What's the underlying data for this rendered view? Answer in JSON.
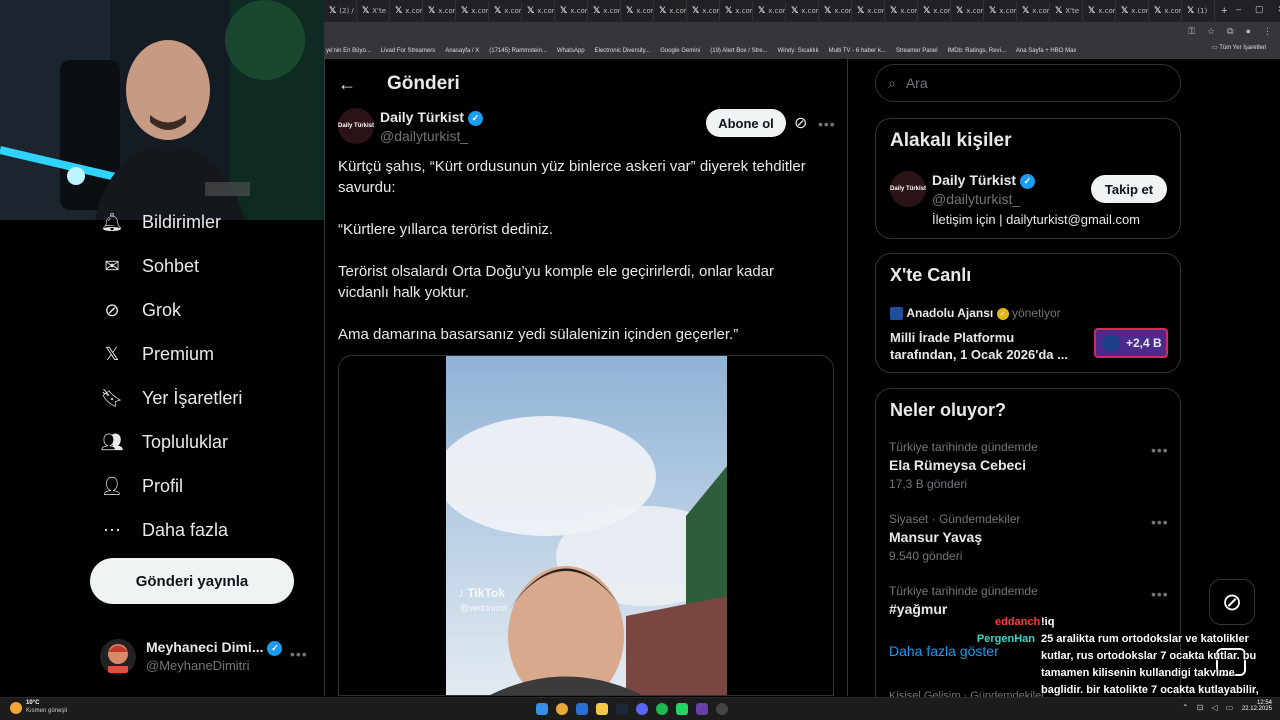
{
  "browser": {
    "tabs": [
      "(2) / X",
      "X'te",
      "x.com",
      "x.com",
      "x.com",
      "x.com",
      "x.com",
      "x.com",
      "x.com",
      "x.com",
      "x.com",
      "x.com",
      "x.com",
      "x.com",
      "x.com",
      "x.com",
      "x.com",
      "x.com",
      "x.com",
      "x.com",
      "x.com",
      "x.com",
      "X'te",
      "x.com",
      "x.com",
      "x.com",
      "(1)"
    ],
    "bookmarks": [
      "ye'nin En Büyo...",
      "Livad For Streamers",
      "Anasayfa / X",
      "(17145) Rammstein...",
      "WhatsApp",
      "Electronic Diversity...",
      "Google Gemini",
      "(19) Alert Box / Stre...",
      "Windy: Sıcaklık",
      "Multi TV - 6 haber k...",
      "Streamer Panel",
      "IMDb: Ratings, Revi...",
      "Ana Sayfa + HBO Max"
    ],
    "all_bookmarks": "Tüm Yer İşaretleri"
  },
  "nav": {
    "items": [
      {
        "label": "Bildirimler",
        "icon": "bell-icon"
      },
      {
        "label": "Sohbet",
        "icon": "mail-icon"
      },
      {
        "label": "Grok",
        "icon": "grok-icon"
      },
      {
        "label": "Premium",
        "icon": "x-logo-icon"
      },
      {
        "label": "Yer İşaretleri",
        "icon": "bookmark-icon"
      },
      {
        "label": "Topluluklar",
        "icon": "communities-icon"
      },
      {
        "label": "Profil",
        "icon": "person-icon"
      },
      {
        "label": "Daha fazla",
        "icon": "more-circle-icon"
      }
    ],
    "post_button": "Gönderi yayınla",
    "account": {
      "name": "Meyhaneci Dimi...",
      "handle": "@MeyhaneDimitri"
    }
  },
  "post": {
    "header_title": "Gönderi",
    "author_name": "Daily Türkist",
    "author_handle": "@dailyturkist_",
    "avatar_text": "Daily Türkist",
    "subscribe_label": "Abone ol",
    "paragraphs": [
      "Kürtçü şahıs, “Kürt ordusunun yüz binlerce askeri var” diyerek tehditler savurdu:",
      "“Kürtlere yıllarca terörist dediniz.",
      "Terörist olsalardı Orta Doğu’yu komple ele geçirirlerdi, onlar kadar vicdanlı halk yoktur.",
      "Ama damarına basarsanız yedi sülalenizin içinden geçerler.”"
    ],
    "video_watermark": "TikTok",
    "video_handle": "@vedonizm"
  },
  "search": {
    "placeholder": "Ara"
  },
  "related": {
    "title": "Alakalı kişiler",
    "name": "Daily Türkist",
    "handle": "@dailyturkist_",
    "bio": "İletişim için | dailyturkist@gmail.com",
    "follow_label": "Takip et"
  },
  "live": {
    "title": "X'te Canlı",
    "host": "Anadolu Ajansı",
    "role": "yönetiyor",
    "text_line1": "Milli İrade Platformu",
    "text_line2": "tarafından, 1 Ocak 2026'da ...",
    "listeners": "+2,4 B"
  },
  "trends": {
    "title": "Neler oluyor?",
    "items": [
      {
        "context": "Türkiye tarihinde gündemde",
        "name": "Ela Rümeysa Cebeci",
        "count": "17,3 B gönderi"
      },
      {
        "context": "Siyaset · Gündemdekiler",
        "name": "Mansur Yavaş",
        "count": "9.540 gönderi"
      },
      {
        "context": "Türkiye tarihinde gündemde",
        "name": "#yağmur",
        "count": ""
      }
    ],
    "show_more": "Daha fazla göster",
    "cut_off": "Kişisel Gelişim · Gündemdekiler"
  },
  "chat": {
    "lines": [
      {
        "user": "eddanch",
        "color": "#ff3a3a",
        "text": "!iq"
      },
      {
        "user": "PergenHan",
        "color": "#3ad6c8",
        "text": "25 aralikta rum ortodokslar ve katolikler kutlar, rus ortodokslar 7 ocakta kutlar. bu tamamen kilisenin kullandigi takvime baglidir. bir katolikte 7 ocakta kutlayabilir, kilisenin kullandigi takvim onemli"
      }
    ]
  },
  "taskbar": {
    "weather_temp": "10°C",
    "weather_desc": "Kısmen güneşli",
    "time": "12:54",
    "date": "22.12.2025"
  },
  "colors": {
    "accent": "#1d9bf0",
    "muted": "#71767b",
    "live_border": "#e0245e",
    "background": "#000000"
  }
}
